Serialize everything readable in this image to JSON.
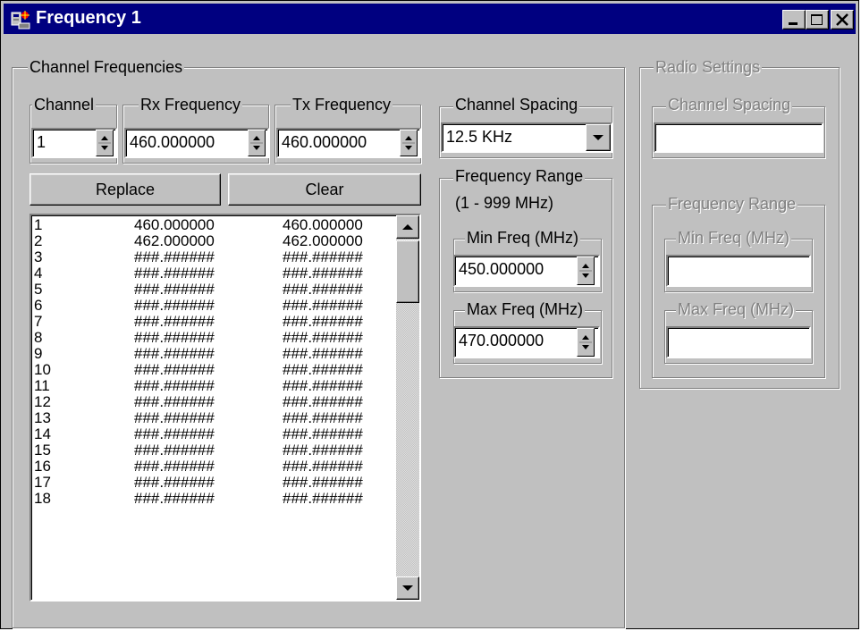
{
  "window": {
    "title": "Frequency 1"
  },
  "channel_group": {
    "label": "Channel Frequencies",
    "channel": {
      "label": "Channel",
      "value": "1"
    },
    "rx": {
      "label": "Rx Frequency",
      "value": "460.000000"
    },
    "tx": {
      "label": "Tx Frequency",
      "value": "460.000000"
    },
    "replace_label": "Replace",
    "clear_label": "Clear",
    "list": [
      [
        "1",
        "460.000000",
        "460.000000"
      ],
      [
        "2",
        "462.000000",
        "462.000000"
      ],
      [
        "3",
        "###.######",
        "###.######"
      ],
      [
        "4",
        "###.######",
        "###.######"
      ],
      [
        "5",
        "###.######",
        "###.######"
      ],
      [
        "6",
        "###.######",
        "###.######"
      ],
      [
        "7",
        "###.######",
        "###.######"
      ],
      [
        "8",
        "###.######",
        "###.######"
      ],
      [
        "9",
        "###.######",
        "###.######"
      ],
      [
        "10",
        "###.######",
        "###.######"
      ],
      [
        "11",
        "###.######",
        "###.######"
      ],
      [
        "12",
        "###.######",
        "###.######"
      ],
      [
        "13",
        "###.######",
        "###.######"
      ],
      [
        "14",
        "###.######",
        "###.######"
      ],
      [
        "15",
        "###.######",
        "###.######"
      ],
      [
        "16",
        "###.######",
        "###.######"
      ],
      [
        "17",
        "###.######",
        "###.######"
      ],
      [
        "18",
        "###.######",
        "###.######"
      ]
    ],
    "spacing": {
      "label": "Channel Spacing",
      "value": "12.5 KHz"
    },
    "range": {
      "label": "Frequency Range",
      "subtitle": "(1 - 999 MHz)",
      "min": {
        "label": "Min Freq (MHz)",
        "value": "450.000000"
      },
      "max": {
        "label": "Max Freq (MHz)",
        "value": "470.000000"
      }
    }
  },
  "radio_group": {
    "label": "Radio Settings",
    "spacing_label": "Channel Spacing",
    "range_label": "Frequency Range",
    "min_label": "Min Freq (MHz)",
    "max_label": "Max Freq (MHz)"
  },
  "colors": {
    "titlebar": "#000080",
    "face": "#c0c0c0",
    "disabled_text": "#808080"
  },
  "icons": [
    "app-icon",
    "minimize-icon",
    "maximize-icon",
    "close-icon",
    "spin-up-icon",
    "spin-down-icon",
    "dropdown-arrow-icon",
    "scroll-up-icon",
    "scroll-down-icon"
  ]
}
